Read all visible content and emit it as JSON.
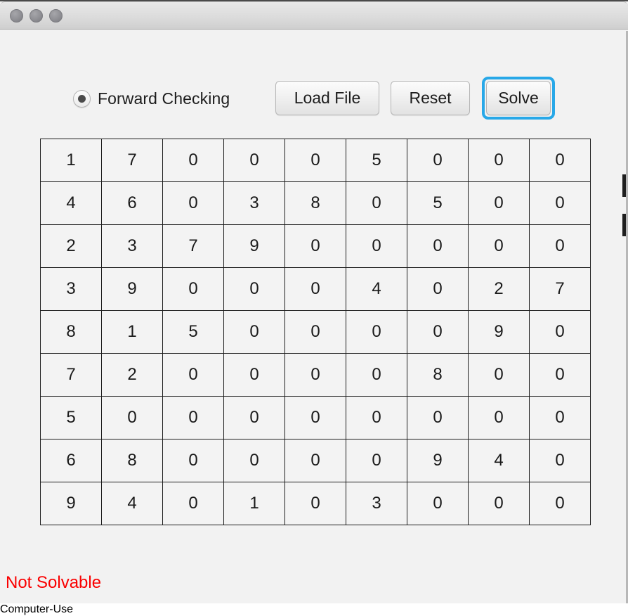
{
  "window": {
    "title": "",
    "traffic_lights": [
      "close",
      "minimize",
      "zoom"
    ],
    "background_color": "#f2f2f2",
    "titlebar_color": "#dcdcdc"
  },
  "toolbar": {
    "algorithm_radio": {
      "label": "Forward Checking",
      "selected": true
    },
    "load_file_label": "Load File",
    "reset_label": "Reset",
    "solve_label": "Solve",
    "focused_button": "Solve",
    "focus_ring_color": "#28a8e8"
  },
  "board": {
    "rows": 9,
    "cols": 9,
    "empty_value": "0",
    "cell_background": "#f3f3f3",
    "border_color": "#1e1e1e",
    "grid": [
      [
        "1",
        "7",
        "0",
        "0",
        "0",
        "5",
        "0",
        "0",
        "0"
      ],
      [
        "4",
        "6",
        "0",
        "3",
        "8",
        "0",
        "5",
        "0",
        "0"
      ],
      [
        "2",
        "3",
        "7",
        "9",
        "0",
        "0",
        "0",
        "0",
        "0"
      ],
      [
        "3",
        "9",
        "0",
        "0",
        "0",
        "4",
        "0",
        "2",
        "7"
      ],
      [
        "8",
        "1",
        "5",
        "0",
        "0",
        "0",
        "0",
        "9",
        "0"
      ],
      [
        "7",
        "2",
        "0",
        "0",
        "0",
        "0",
        "8",
        "0",
        "0"
      ],
      [
        "5",
        "0",
        "0",
        "0",
        "0",
        "0",
        "0",
        "0",
        "0"
      ],
      [
        "6",
        "8",
        "0",
        "0",
        "0",
        "0",
        "9",
        "4",
        "0"
      ],
      [
        "9",
        "4",
        "0",
        "1",
        "0",
        "3",
        "0",
        "0",
        "0"
      ]
    ]
  },
  "status": {
    "message": "Not Solvable",
    "color": "#fa0000"
  }
}
